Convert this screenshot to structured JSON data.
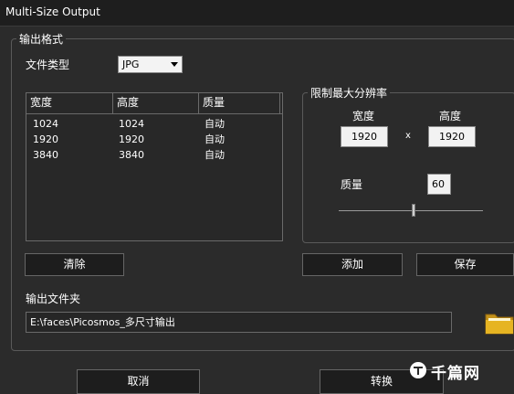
{
  "window": {
    "title": "Multi-Size Output"
  },
  "output_format": {
    "group_label": "输出格式",
    "file_type_label": "文件类型",
    "file_type_value": "JPG"
  },
  "size_table": {
    "headers": [
      "宽度",
      "高度",
      "质量"
    ],
    "rows": [
      [
        "1024",
        "1024",
        "自动"
      ],
      [
        "1920",
        "1920",
        "自动"
      ],
      [
        "3840",
        "3840",
        "自动"
      ]
    ]
  },
  "max_resolution": {
    "group_label": "限制最大分辨率",
    "width_label": "宽度",
    "height_label": "高度",
    "width_value": "1920",
    "separator": "x",
    "height_value": "1920",
    "quality_label": "质量",
    "quality_value": "60",
    "quality_slider_fraction": 0.52
  },
  "buttons": {
    "clear": "清除",
    "add": "添加",
    "save": "保存",
    "cancel": "取消",
    "convert": "转换"
  },
  "output_folder": {
    "label": "输出文件夹",
    "path": "E:\\faces\\Picosmos_多尺寸输出"
  },
  "watermark": {
    "text": "千篇网"
  },
  "colors": {
    "background": "#2b2b2b",
    "folder": "#e6b422",
    "watermark": "#ffffff"
  }
}
